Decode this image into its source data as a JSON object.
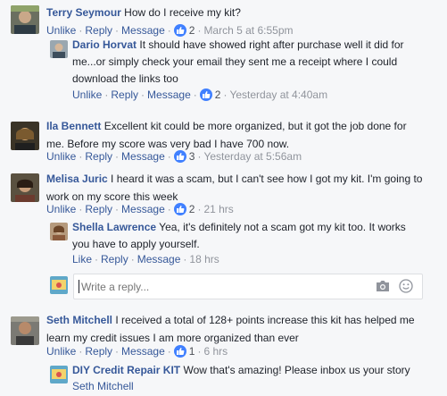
{
  "actions": {
    "unlike": "Unlike",
    "like": "Like",
    "reply": "Reply",
    "message": "Message",
    "sep": "·"
  },
  "comments": [
    {
      "author": "Terry Seymour",
      "text": "How do I receive my kit?",
      "likes": "2",
      "time": "March 5 at 6:55pm",
      "reply": {
        "author": "Dario Horvat",
        "text_line1": "It should have showed right after purchase well it did for",
        "text_line2": "me...or simply check your email they sent me a receipt where I could",
        "text_line3": "download the links too",
        "likes": "2",
        "time": "Yesterday at 4:40am"
      }
    },
    {
      "author": "Ila Bennett",
      "text_line1": "Excellent kit could be more organized, but it got the job done for",
      "text_line2": "me. Before my score was very bad I have 700 now.",
      "likes": "3",
      "time": "Yesterday at 5:56am"
    },
    {
      "author": "Melisa Juric",
      "text_line1": "I heard it was a scam, but I can't see how I got my kit. I'm going to",
      "text_line2": "work on my score this week",
      "likes": "2",
      "time": "21 hrs",
      "reply": {
        "author": "Shella Lawrence",
        "text_line1": "Yea, it's definitely not a scam got my kit too. It works",
        "text_line2": "you have to apply yourself.",
        "time": "18 hrs"
      }
    },
    {
      "author": "Seth Mitchell",
      "text_line1": "I received a total of 128+ points increase this kit has helped me",
      "text_line2": "learn my credit issues I am more organized than ever",
      "likes": "1",
      "time": "6 hrs",
      "reply": {
        "author": "DIY Credit Repair KIT",
        "text": "Wow that's amazing! Please inbox us your story",
        "tag": "Seth Mitchell"
      }
    }
  ],
  "reply_box": {
    "placeholder": "Write a reply..."
  },
  "colors": {
    "link": "#365899",
    "like_badge": "#4080ff",
    "background": "#f6f7f9"
  }
}
